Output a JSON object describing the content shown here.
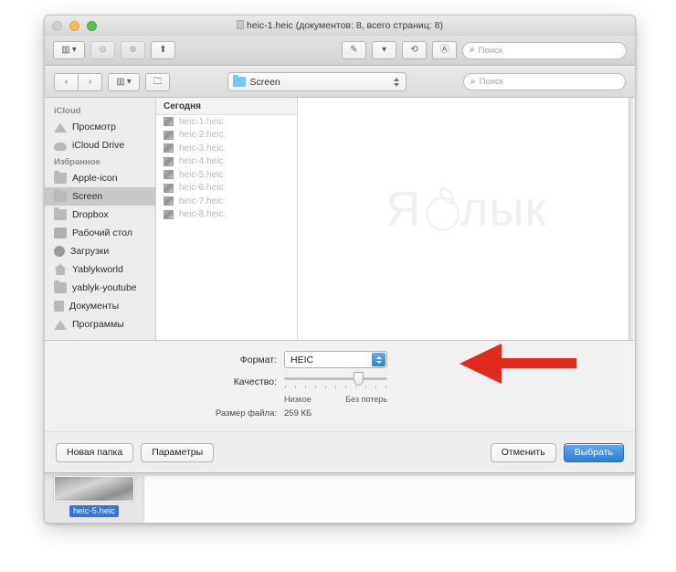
{
  "window": {
    "title": "heic-1.heic (документов: 8, всего страниц: 8)",
    "title_icon": "document-icon",
    "traffic_lights": [
      "close",
      "minimize",
      "maximize"
    ]
  },
  "toolbar": {
    "sidebar_toggle": "▥",
    "sidebar_caret": "▾",
    "zoom_out": "⊖",
    "zoom_in": "⊕",
    "share": "⬆",
    "markup": "✎",
    "markup_caret": "▾",
    "rotate": "⟲",
    "annotate": "Ⓐ",
    "search_placeholder": "Поиск"
  },
  "navbar": {
    "back": "‹",
    "forward": "›",
    "view_mode": "▥",
    "view_caret": "▾",
    "new_folder_icon": "🗀",
    "location": "Screen",
    "search_placeholder": "Поиск"
  },
  "sidebar": {
    "sections": [
      {
        "header": "iCloud",
        "items": [
          {
            "label": "Просмотр",
            "icon": "airdrop-icon",
            "selected": false
          },
          {
            "label": "iCloud Drive",
            "icon": "cloud-icon",
            "selected": false
          }
        ]
      },
      {
        "header": "Избранное",
        "items": [
          {
            "label": "Apple-icon",
            "icon": "folder-icon",
            "selected": false
          },
          {
            "label": "Screen",
            "icon": "folder-icon",
            "selected": true
          },
          {
            "label": "Dropbox",
            "icon": "folder-icon",
            "selected": false
          },
          {
            "label": "Рабочий стол",
            "icon": "desktop-icon",
            "selected": false
          },
          {
            "label": "Загрузки",
            "icon": "downloads-icon",
            "selected": false
          },
          {
            "label": "Yablykworld",
            "icon": "home-icon",
            "selected": false
          },
          {
            "label": "yablyk-youtube",
            "icon": "folder-icon",
            "selected": false
          },
          {
            "label": "Документы",
            "icon": "documents-icon",
            "selected": false
          },
          {
            "label": "Программы",
            "icon": "applications-icon",
            "selected": false
          }
        ]
      }
    ]
  },
  "filelist": {
    "group_header": "Сегодня",
    "files": [
      "heic-1.heic",
      "heic-2.heic",
      "heic-3.heic",
      "heic-4.heic",
      "heic-5.heic",
      "heic-6.heic",
      "heic-7.heic",
      "heic-8.heic"
    ]
  },
  "preview": {
    "watermark_left": "Я",
    "watermark_right": "лык"
  },
  "options": {
    "format_label": "Формат:",
    "format_value": "HEIC",
    "quality_label": "Качество:",
    "quality_min": "Низкое",
    "quality_max": "Без потерь",
    "quality_percent": 72,
    "filesize_label": "Размер файла:",
    "filesize_value": "259 КБ"
  },
  "footer": {
    "new_folder": "Новая папка",
    "parameters": "Параметры",
    "cancel": "Отменить",
    "choose": "Выбрать"
  },
  "behind": {
    "selected_file": "heic-5.heic"
  },
  "annotation": {
    "arrow_color": "#e02b1c",
    "points_to": "format-select"
  },
  "colors": {
    "accent_blue": "#2c7fd7",
    "selection_blue": "#3b73d4",
    "arrow_red": "#e02b1c"
  }
}
